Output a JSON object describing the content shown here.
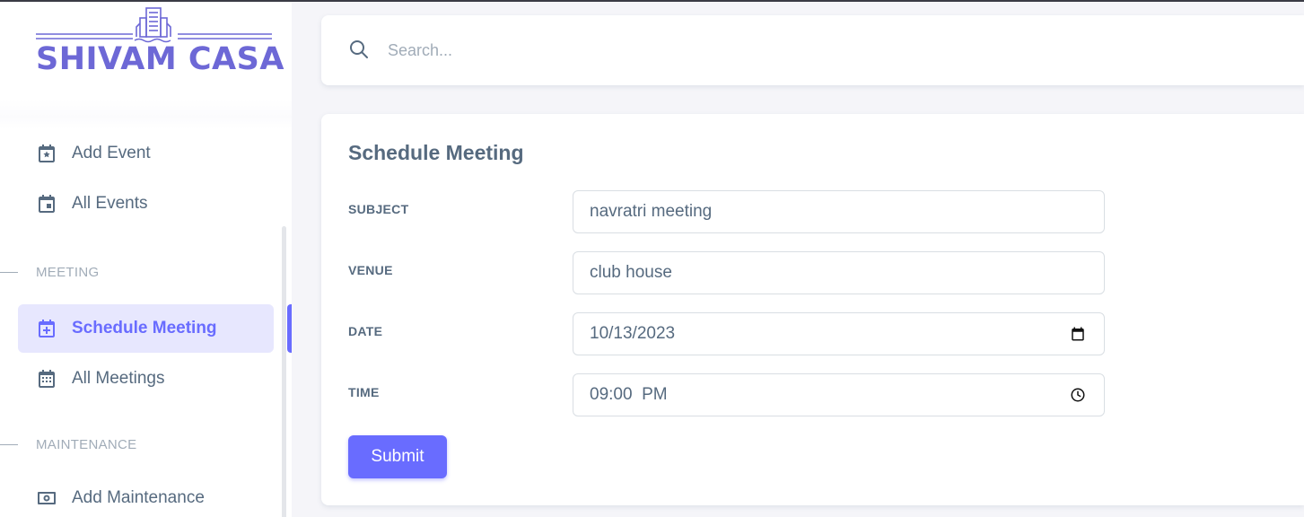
{
  "brand": {
    "name": "SHIVAM CASA",
    "color": "#6d68d6"
  },
  "sidebar": {
    "items": [
      {
        "label": "Add Event",
        "icon": "calendar-star-icon",
        "active": false
      },
      {
        "label": "All Events",
        "icon": "calendar-event-icon",
        "active": false
      },
      {
        "label": "Schedule Meeting",
        "icon": "calendar-plus-icon",
        "active": true
      },
      {
        "label": "All Meetings",
        "icon": "calendar-grid-icon",
        "active": false
      },
      {
        "label": "Add Maintenance",
        "icon": "money-icon",
        "active": false
      }
    ],
    "headers": [
      "MEETING",
      "MAINTENANCE"
    ]
  },
  "search": {
    "placeholder": "Search..."
  },
  "form": {
    "title": "Schedule Meeting",
    "fields": [
      {
        "label": "SUBJECT",
        "value": "navratri meeting"
      },
      {
        "label": "VENUE",
        "value": "club house"
      },
      {
        "label": "DATE",
        "value": "10/13/2023"
      },
      {
        "label": "TIME",
        "value": "09:00  PM"
      }
    ],
    "submit_label": "Submit"
  },
  "colors": {
    "accent": "#696cff",
    "active_bg": "#e7e7fe",
    "text": "#566a7f",
    "muted": "#a1acb8"
  }
}
